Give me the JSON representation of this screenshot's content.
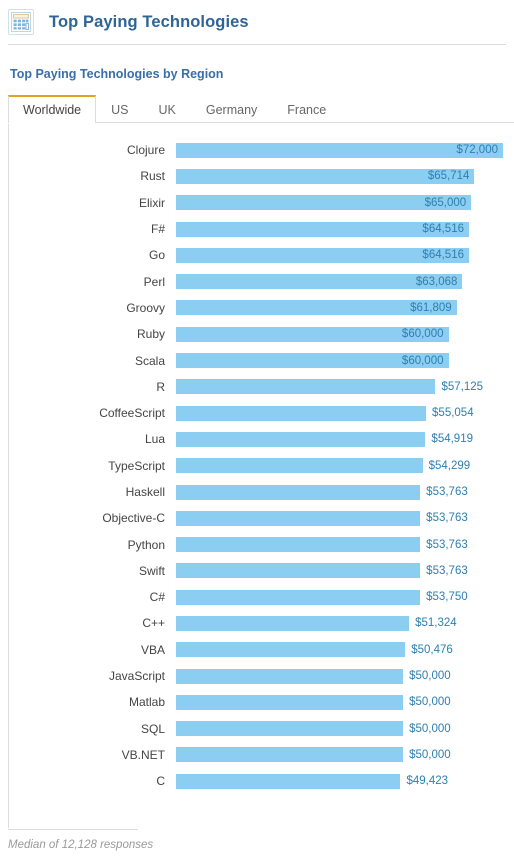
{
  "header": {
    "title": "Top Paying Technologies",
    "icon": "calculator-icon"
  },
  "section": {
    "title": "Top Paying Technologies by Region"
  },
  "tabs": [
    {
      "label": "Worldwide",
      "active": true
    },
    {
      "label": "US",
      "active": false
    },
    {
      "label": "UK",
      "active": false
    },
    {
      "label": "Germany",
      "active": false
    },
    {
      "label": "France",
      "active": false
    }
  ],
  "footer": {
    "note": "Median of 12,128 responses"
  },
  "colors": {
    "bar": "#8ccdf2",
    "value_text": "#2e7fb0",
    "title": "#2f6496",
    "section_title": "#3a6ea8",
    "active_tab_accent": "#e2a322"
  },
  "chart_data": {
    "type": "bar",
    "orientation": "horizontal",
    "title": "Top Paying Technologies by Region",
    "xlabel": "",
    "ylabel": "",
    "xlim": [
      0,
      72000
    ],
    "grid": false,
    "legend": null,
    "value_prefix": "$",
    "inside_label_threshold": 60000,
    "categories": [
      "Clojure",
      "Rust",
      "Elixir",
      "F#",
      "Go",
      "Perl",
      "Groovy",
      "Ruby",
      "Scala",
      "R",
      "CoffeeScript",
      "Lua",
      "TypeScript",
      "Haskell",
      "Objective-C",
      "Python",
      "Swift",
      "C#",
      "C++",
      "VBA",
      "JavaScript",
      "Matlab",
      "SQL",
      "VB.NET",
      "C"
    ],
    "values": [
      72000,
      65714,
      65000,
      64516,
      64516,
      63068,
      61809,
      60000,
      60000,
      57125,
      55054,
      54919,
      54299,
      53763,
      53763,
      53763,
      53763,
      53750,
      51324,
      50476,
      50000,
      50000,
      50000,
      50000,
      49423
    ],
    "value_labels": [
      "$72,000",
      "$65,714",
      "$65,000",
      "$64,516",
      "$64,516",
      "$63,068",
      "$61,809",
      "$60,000",
      "$60,000",
      "$57,125",
      "$55,054",
      "$54,919",
      "$54,299",
      "$53,763",
      "$53,763",
      "$53,763",
      "$53,763",
      "$53,750",
      "$51,324",
      "$50,476",
      "$50,000",
      "$50,000",
      "$50,000",
      "$50,000",
      "$49,423"
    ],
    "annotation": "Median of 12,128 responses"
  }
}
